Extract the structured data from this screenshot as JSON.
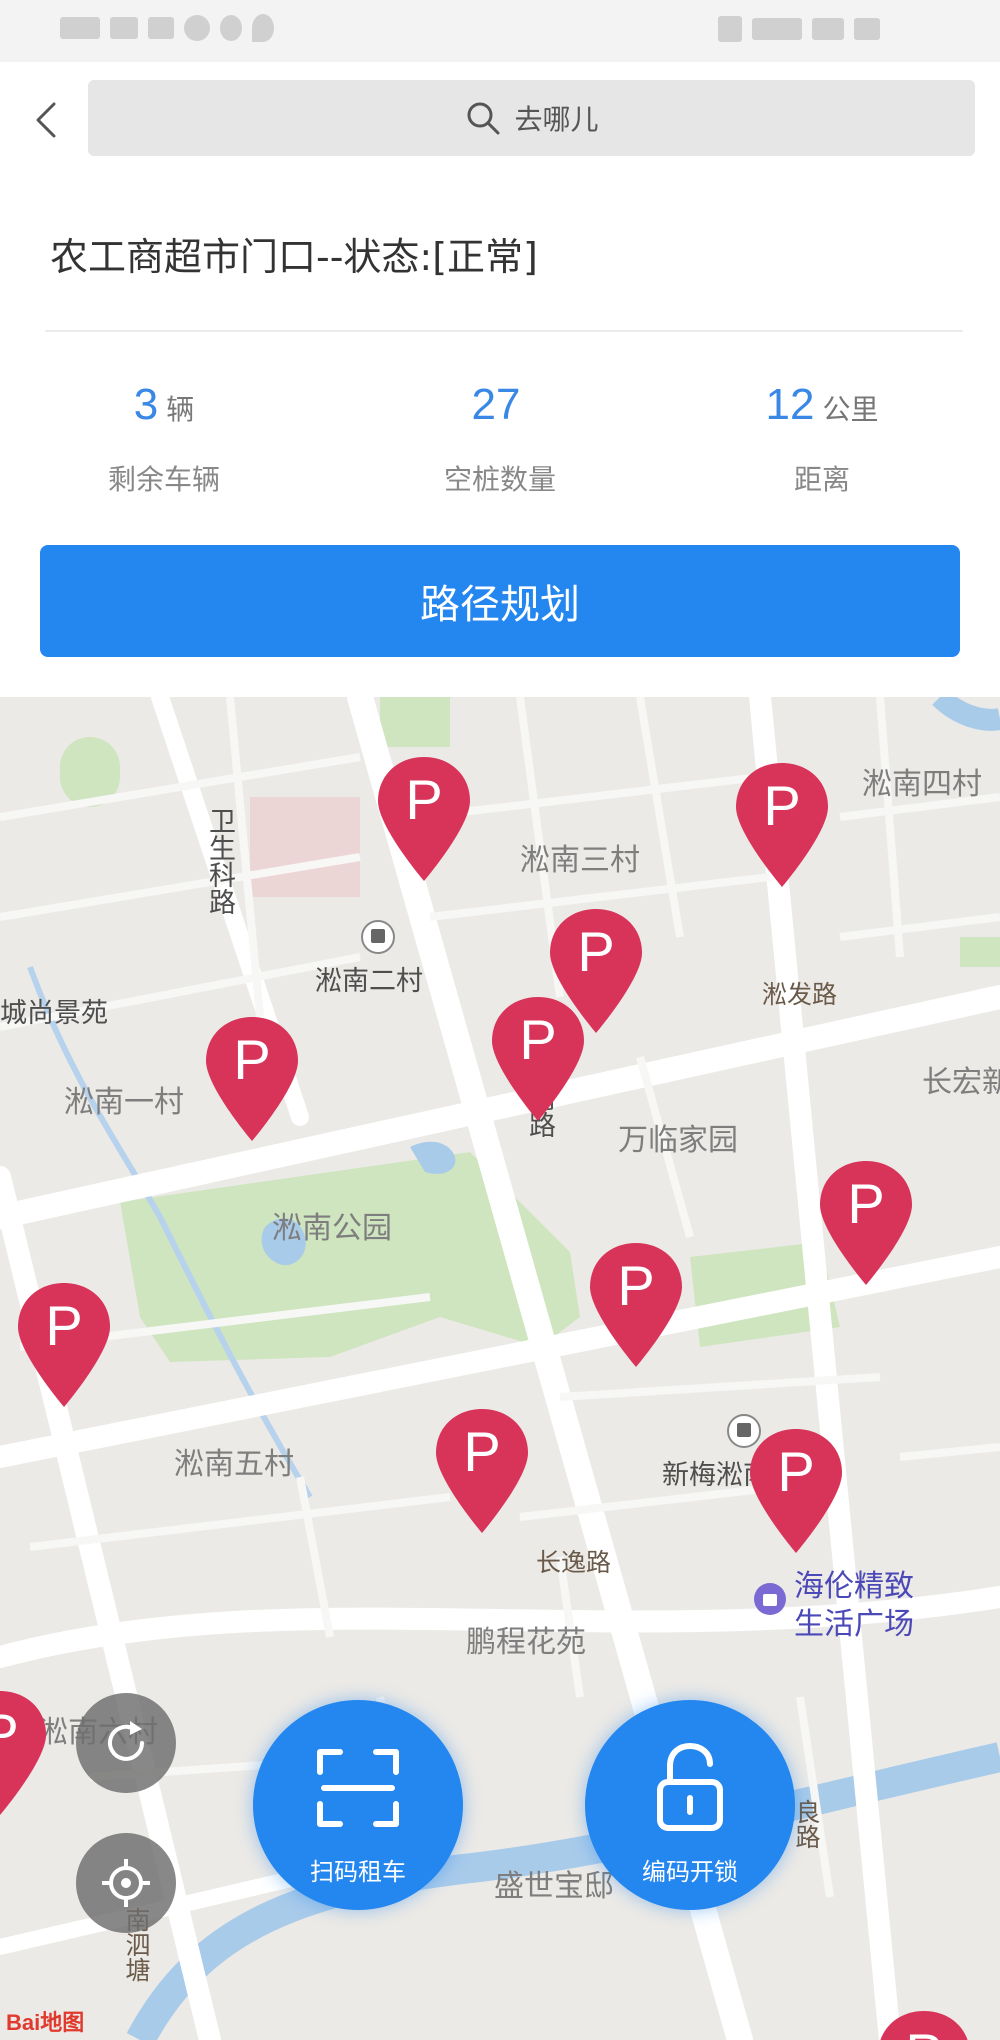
{
  "header": {
    "search_placeholder": "去哪儿"
  },
  "station": {
    "title": "农工商超市门口--状态:[正常]"
  },
  "stats": [
    {
      "value": "3",
      "unit": "辆",
      "label": "剩余车辆"
    },
    {
      "value": "27",
      "unit": "",
      "label": "空桩数量"
    },
    {
      "value": "12",
      "unit": "公里",
      "label": "距离"
    }
  ],
  "route_button": {
    "label": "路径规划"
  },
  "map": {
    "labels": {
      "weisheng_road": "卫生科路",
      "songnan_2": "淞南二村",
      "songnan_3": "淞南三村",
      "songnan_4": "淞南四村",
      "chengshang": "城尚景苑",
      "songnan_1": "淞南一村",
      "wanlin": "万临家园",
      "songnan_park": "淞南公园",
      "songfa_road": "淞发路",
      "changhong": "长宏新",
      "songnan_5": "淞南五村",
      "xinmei": "新梅淞南",
      "changyi_road": "长逸路",
      "haolun": "海伦精致",
      "haolun_2": "生活广场",
      "pengcheng": "鹏程花苑",
      "songnan_6": "淞南六村",
      "shengshi": "盛世宝邸",
      "songnan_road": "淞南路",
      "sihe_road": "南泗塘",
      "liang_road": "良路"
    },
    "pin_count": 12,
    "pin_letter": "P",
    "pin_color": "#d8345a",
    "attribution": "Bai地图"
  },
  "actions": {
    "scan_label": "扫码租车",
    "code_label": "编码开锁"
  }
}
